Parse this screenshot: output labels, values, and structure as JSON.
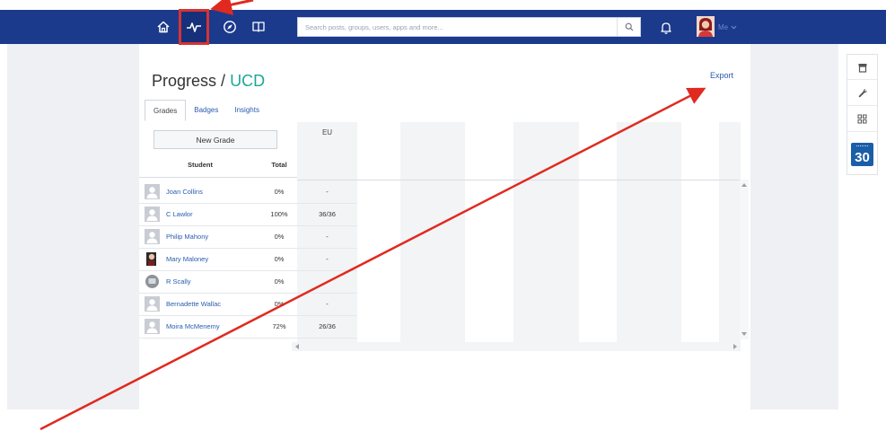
{
  "nav": {
    "search_placeholder": "Search posts, groups, users, apps and more...",
    "user_label": "Me",
    "bar_color": "#1b3a8c",
    "icons": [
      "home-icon",
      "activity-icon",
      "compass-icon",
      "book-icon",
      "search-icon",
      "bell-icon",
      "chevron-down-icon"
    ]
  },
  "page": {
    "title": "Progress",
    "separator": "/",
    "course": "UCD",
    "export_label": "Export",
    "tabs": [
      {
        "label": "Grades",
        "active": true
      },
      {
        "label": "Badges",
        "active": false
      },
      {
        "label": "Insights",
        "active": false
      }
    ],
    "new_grade_label": "New Grade",
    "columns": {
      "student": "Student",
      "total": "Total",
      "grade_col": "EU"
    },
    "students": [
      {
        "name": "Joan Collins",
        "total": "0%",
        "eu": "-",
        "avatar": "placeholder"
      },
      {
        "name": "C Lawlor",
        "total": "100%",
        "eu": "36/36",
        "avatar": "placeholder"
      },
      {
        "name": "Philip Mahony",
        "total": "0%",
        "eu": "-",
        "avatar": "placeholder"
      },
      {
        "name": "Mary Maloney",
        "total": "0%",
        "eu": "-",
        "avatar": "photo"
      },
      {
        "name": "R Scally",
        "total": "0%",
        "eu": "",
        "avatar": "round"
      },
      {
        "name": "Bernadette Wallac",
        "total": "0%",
        "eu": "-",
        "avatar": "placeholder"
      },
      {
        "name": "Moira McMenemy",
        "total": "72%",
        "eu": "26/36",
        "avatar": "placeholder"
      }
    ]
  },
  "tools": {
    "calendar_day": "30",
    "icons": [
      "store-icon",
      "wrench-icon",
      "grid-icon",
      "calendar-icon"
    ]
  },
  "colors": {
    "accent": "#1aa79a",
    "link": "#2a5bb0",
    "annotation": "#e02a1f"
  }
}
